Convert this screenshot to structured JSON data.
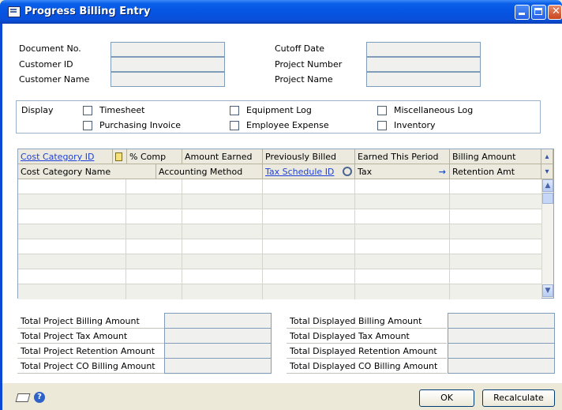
{
  "window": {
    "title": "Progress Billing Entry"
  },
  "header": {
    "document_no_label": "Document No.",
    "customer_id_label": "Customer ID",
    "customer_name_label": "Customer Name",
    "cutoff_date_label": "Cutoff Date",
    "project_number_label": "Project Number",
    "project_name_label": "Project Name",
    "document_no_value": "",
    "customer_id_value": "",
    "customer_name_value": "",
    "cutoff_date_value": "",
    "project_number_value": "",
    "project_name_value": ""
  },
  "display": {
    "label": "Display",
    "options": [
      "Timesheet",
      "Purchasing Invoice",
      "Equipment Log",
      "Employee Expense",
      "Miscellaneous Log",
      "Inventory"
    ]
  },
  "grid": {
    "row1_headers": [
      "Cost Category ID",
      "% Comp",
      "Amount Earned",
      "Previously Billed",
      "Earned This Period",
      "Billing Amount"
    ],
    "row2_headers": [
      "Cost Category Name",
      "Accounting Method",
      "Tax Schedule ID",
      "Tax",
      "Retention Amt"
    ]
  },
  "totals": {
    "left": [
      "Total Project Billing Amount",
      "Total Project Tax Amount",
      "Total Project Retention Amount",
      "Total Project CO Billing Amount"
    ],
    "right": [
      "Total Displayed Billing Amount",
      "Total Displayed Tax Amount",
      "Total Displayed Retention Amount",
      "Total Displayed CO Billing Amount"
    ]
  },
  "buttons": {
    "ok": "OK",
    "recalculate": "Recalculate"
  },
  "icons": [
    "notes-icon",
    "help-icon",
    "lookup-icon",
    "expand-icon",
    "collapse-icon",
    "arrow-right-icon",
    "note-icon"
  ]
}
